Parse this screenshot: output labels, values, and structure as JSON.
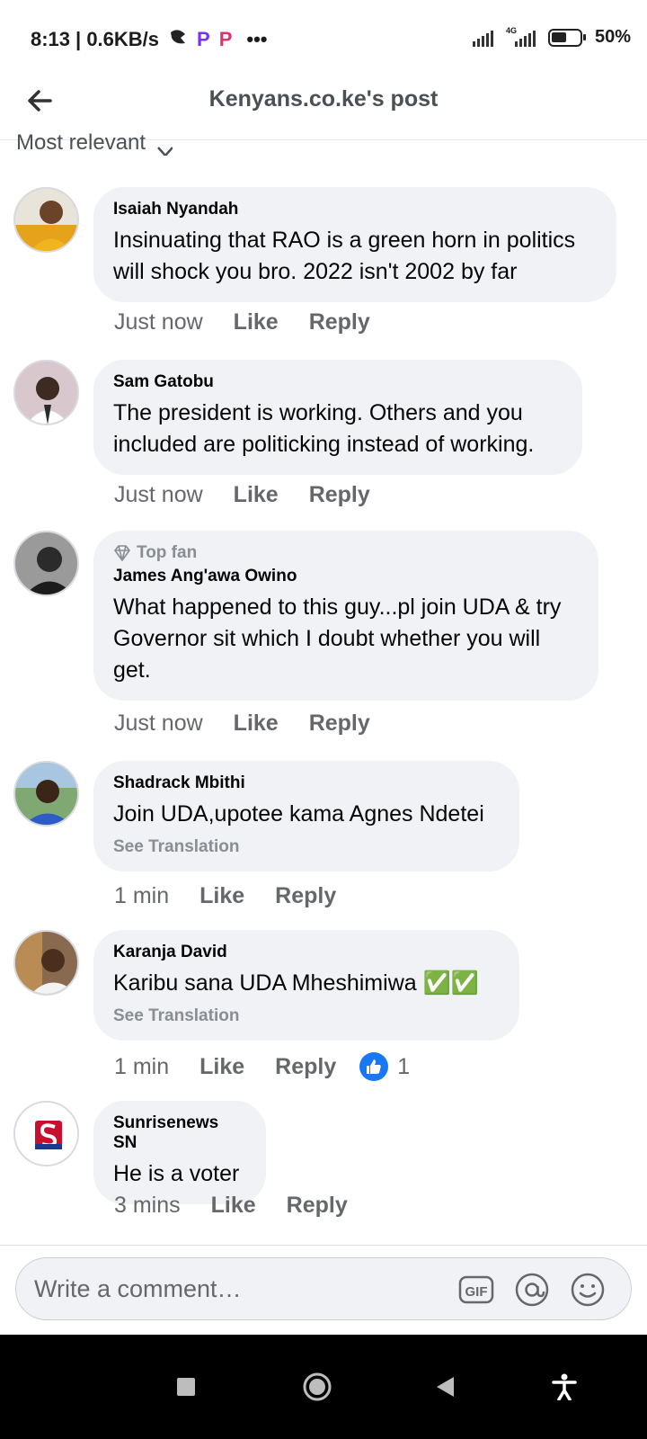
{
  "status_bar": {
    "time": "8:13",
    "speed": "| 0.6KB/s",
    "network": "4G",
    "battery": "50%",
    "more": "•••"
  },
  "header": {
    "title": "Kenyans.co.ke's post"
  },
  "sort": {
    "label": "Most relevant"
  },
  "actions": {
    "like": "Like",
    "reply": "Reply"
  },
  "comments": [
    {
      "author": "Isaiah Nyandah",
      "text": "Insinuating that RAO is a green horn in politics will shock you bro. 2022 isn't 2002 by far",
      "time": "Just now"
    },
    {
      "author": "Sam Gatobu",
      "text": "The president is working. Others and you included are politicking instead of working.",
      "time": "Just now"
    },
    {
      "badge": "Top fan",
      "author": "James Ang'awa Owino",
      "text": "What happened to this guy...pl join UDA & try Governor sit which I doubt whether you will get.",
      "time": "Just now"
    },
    {
      "author": "Shadrack Mbithi",
      "text": "Join UDA,upotee kama Agnes Ndetei",
      "see_translation": "See Translation",
      "time": "1 min"
    },
    {
      "author": "Karanja David",
      "text": "Karibu sana UDA Mheshimiwa ✅✅",
      "see_translation": "See Translation",
      "time": "1 min",
      "reactions": "1"
    },
    {
      "author": "Sunrisenews SN",
      "text": "He is a voter",
      "time": "3 mins"
    }
  ],
  "composer": {
    "placeholder": "Write a comment…",
    "gif_label": "GIF"
  },
  "colors": {
    "bubble": "#f0f2f5",
    "meta": "#65676b",
    "like_blue": "#1877f2"
  }
}
